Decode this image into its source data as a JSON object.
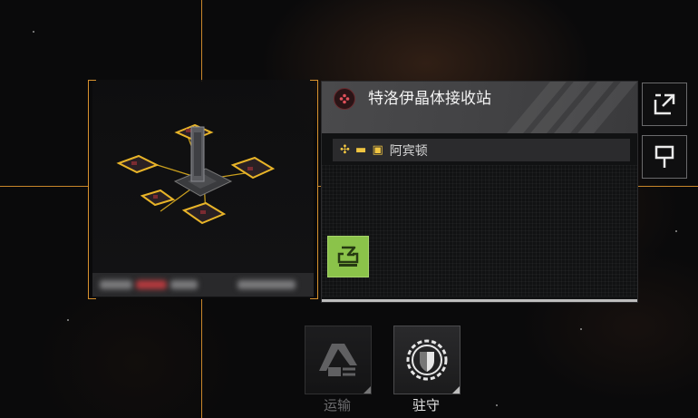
{
  "structure": {
    "name": "特洛伊晶体接收站",
    "owner_symbols": "✣ ▬ ▣",
    "owner_name": "阿宾顿"
  },
  "actions": [
    {
      "label": "运输",
      "enabled": false
    },
    {
      "label": "驻守",
      "enabled": true
    }
  ],
  "icons": {
    "header": "structure-type-icon",
    "dock": "dock-icon",
    "share": "share-icon",
    "pin": "pin-icon",
    "transport": "transport-icon",
    "garrison": "garrison-icon"
  },
  "colors": {
    "accent_orange": "#d7922e",
    "dock_green": "#8bc34a",
    "owner_yellow": "#f0c541"
  }
}
